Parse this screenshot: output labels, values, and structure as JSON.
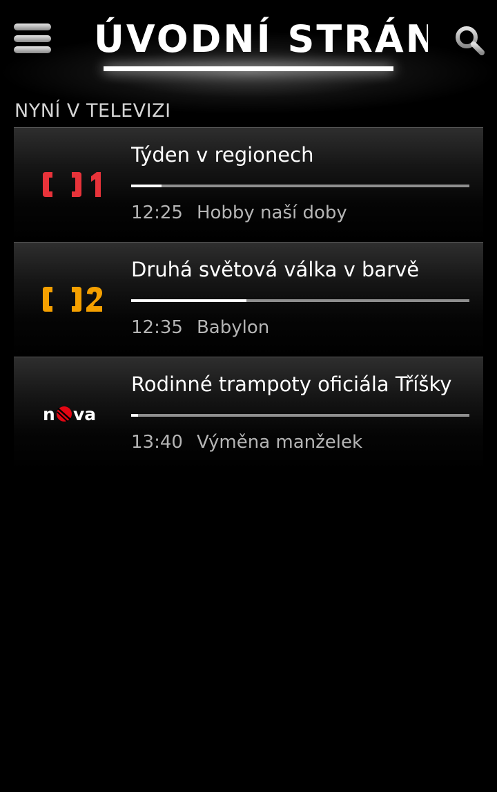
{
  "header": {
    "title": "ÚVODNÍ STRÁNKA"
  },
  "section": {
    "heading": "NYNÍ V TELEVIZI"
  },
  "channels": [
    {
      "logo_icon": "ct1-logo",
      "logo_color": "#e8333a",
      "current_title": "Týden v regionech",
      "progress": 0.09,
      "next_time": "12:25",
      "next_title": "Hobby naší doby"
    },
    {
      "logo_icon": "ct2-logo",
      "logo_color": "#f5a000",
      "current_title": "Druhá světová válka v barvě",
      "progress": 0.34,
      "next_time": "12:35",
      "next_title": "Babylon"
    },
    {
      "logo_icon": "nova-logo",
      "logo_color": "#e30613",
      "logo_text": "nova",
      "current_title": "Rodinné trampoty oficiála Tříšky",
      "progress": 0.02,
      "next_time": "13:40",
      "next_title": "Výměna manželek"
    }
  ]
}
